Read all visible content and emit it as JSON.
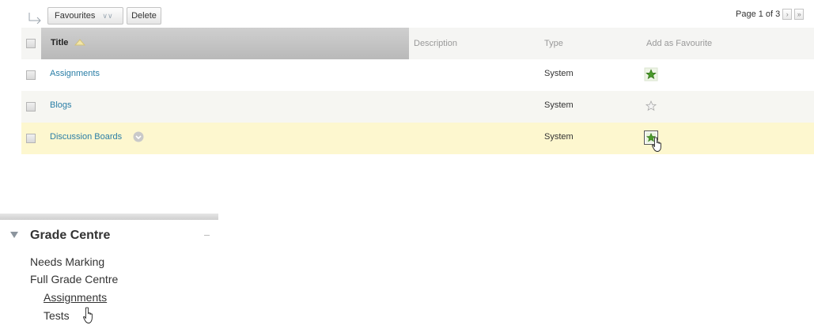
{
  "toolbar": {
    "favourites_label": "Favourites",
    "delete_label": "Delete",
    "pagination": "Page 1 of 3"
  },
  "table": {
    "columns": [
      "Title",
      "Description",
      "Type",
      "Add as Favourite"
    ],
    "rows": [
      {
        "title": "Assignments",
        "type": "System",
        "favourite": true
      },
      {
        "title": "Blogs",
        "type": "System",
        "favourite": false
      },
      {
        "title": "Discussion Boards",
        "type": "System",
        "favourite": true
      }
    ]
  },
  "menu": {
    "title": "Grade Centre",
    "items": [
      "Needs Marking",
      "Full Grade Centre"
    ],
    "subitems": [
      "Assignments",
      "Tests"
    ]
  },
  "icons": {
    "arrow": "corner-arrow-icon",
    "sort": "sort-ascending-icon",
    "star": "star-icon",
    "hand": "hand-pointer-icon",
    "more": "options-menu-icon"
  },
  "colors": {
    "link": "#2a7ea6",
    "star_green": "#4a9a2a",
    "highlight_row": "#fdf7cf",
    "header_title": "#bfbfbf"
  }
}
